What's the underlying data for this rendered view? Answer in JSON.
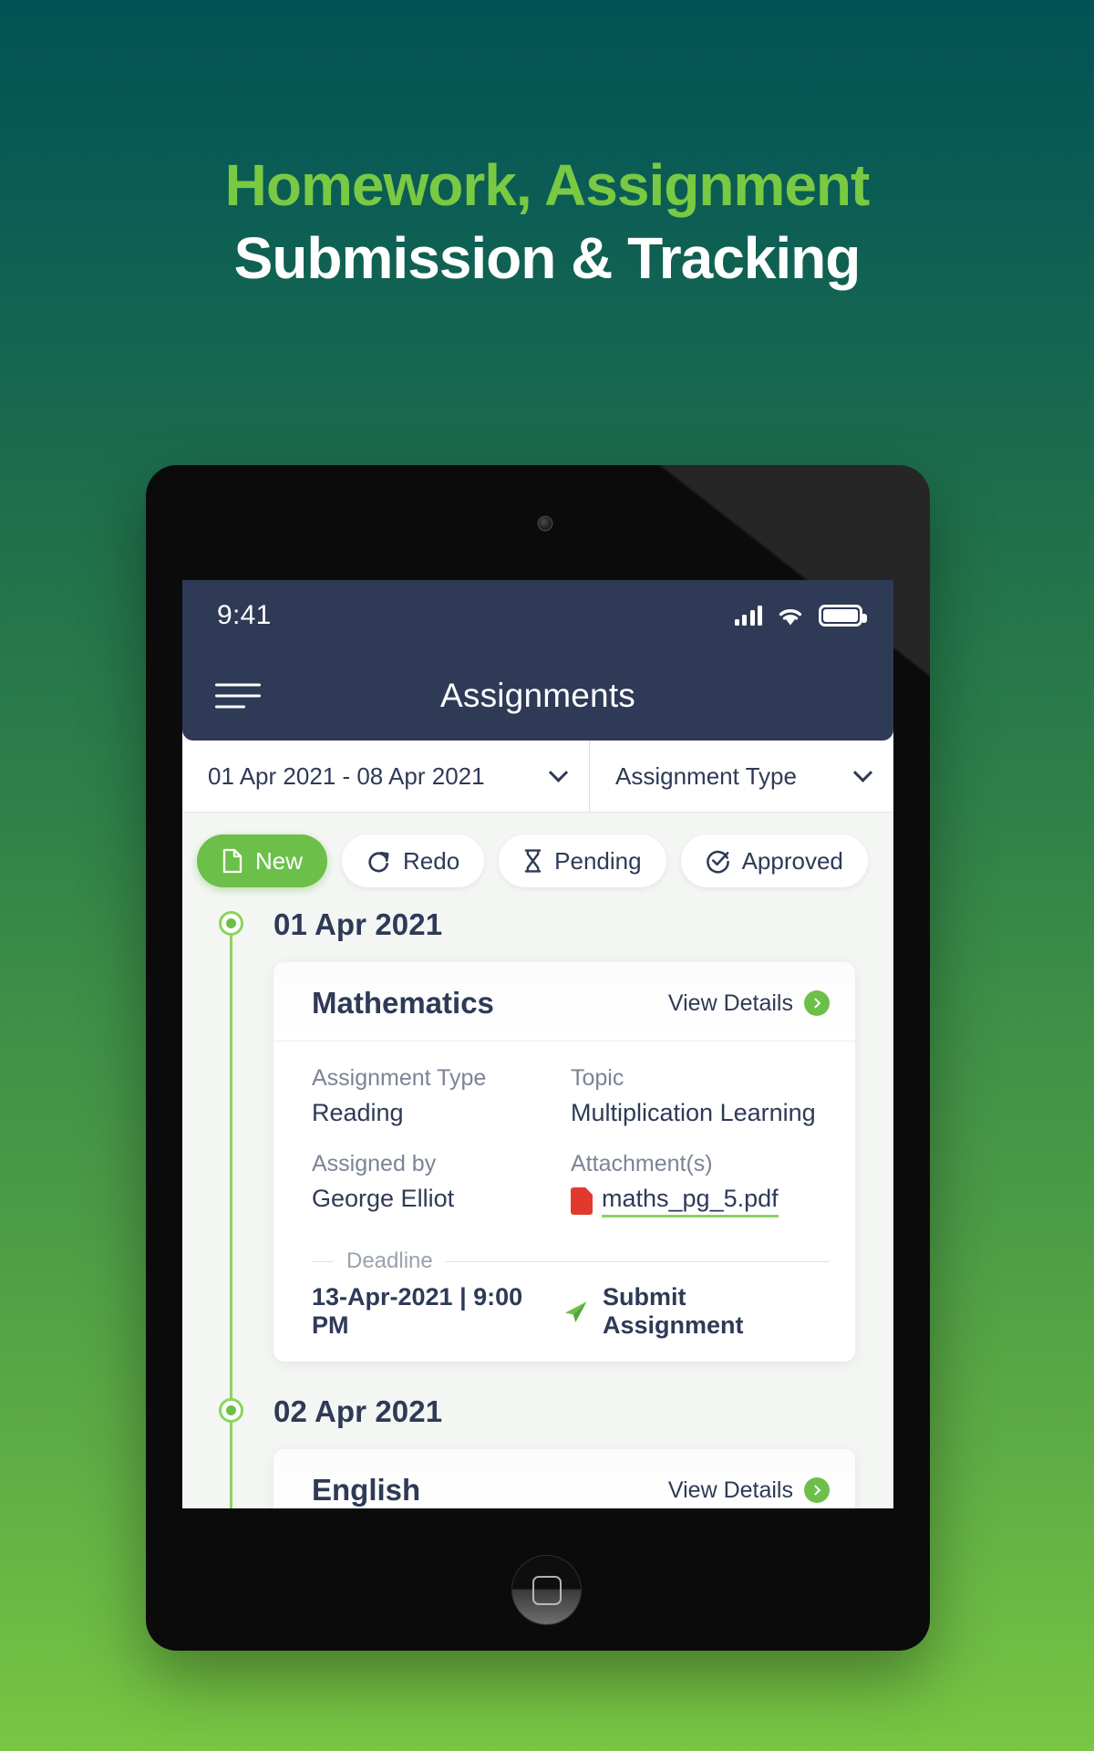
{
  "hero": {
    "line1": "Homework, Assignment",
    "line2": "Submission & Tracking",
    "accent_color": "#7ac943"
  },
  "device": {
    "status_bar": {
      "time": "9:41",
      "signal_icon": "cellular-signal-icon",
      "wifi_icon": "wifi-icon",
      "battery_icon": "battery-full-icon"
    },
    "home_button": "home-button"
  },
  "app": {
    "navbar": {
      "menu_icon": "hamburger-menu-icon",
      "title": "Assignments"
    },
    "filters": [
      {
        "name": "date-range-filter",
        "value": "01 Apr 2021 - 08 Apr 2021"
      },
      {
        "name": "assignment-type-filter",
        "value": "Assignment Type"
      }
    ],
    "tabs": [
      {
        "label": "New",
        "icon": "file-icon",
        "active": true
      },
      {
        "label": "Redo",
        "icon": "redo-icon",
        "active": false
      },
      {
        "label": "Pending",
        "icon": "hourglass-icon",
        "active": false
      },
      {
        "label": "Approved",
        "icon": "check-circle-icon",
        "active": false
      }
    ],
    "timeline": [
      {
        "date": "01 Apr 2021",
        "card": {
          "subject": "Mathematics",
          "view_details": "View Details",
          "fields": [
            {
              "label": "Assignment Type",
              "value": "Reading"
            },
            {
              "label": "Topic",
              "value": "Multiplication Learning"
            },
            {
              "label": "Assigned by",
              "value": "George Elliot"
            },
            {
              "label": "Attachment(s)",
              "value": "maths_pg_5.pdf"
            }
          ],
          "deadline_label": "Deadline",
          "deadline_value": "13-Apr-2021 | 9:00 PM",
          "submit_label": "Submit Assignment"
        }
      },
      {
        "date": "02 Apr 2021",
        "card": {
          "subject": "English",
          "view_details": "View Details"
        }
      }
    ]
  },
  "colors": {
    "accent_green": "#6cc04a",
    "navy": "#2e3a56",
    "rail_green": "#8bd45e",
    "pdf_red": "#e2392e"
  }
}
